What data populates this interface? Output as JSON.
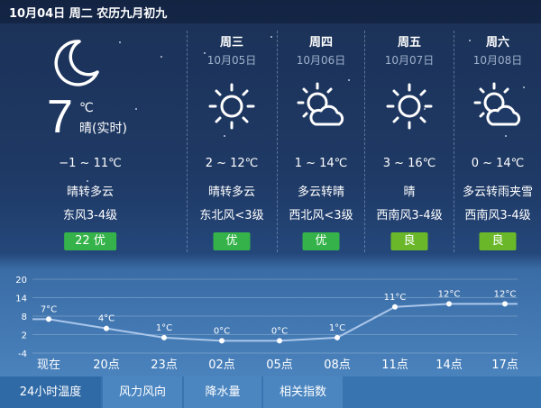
{
  "header": {
    "date_line": "10月04日 周二 农历九月初九"
  },
  "today": {
    "current_temp": "7",
    "unit": "℃",
    "realtime_label": "晴(实时)",
    "temp_range": "−1 ~ 11℃",
    "condition": "晴转多云",
    "wind": "东风3-4级",
    "aqi": "22  优",
    "icon": "moon-icon"
  },
  "forecast": [
    {
      "weekday": "周三",
      "date": "10月05日",
      "temp_range": "2 ~ 12℃",
      "condition": "晴转多云",
      "wind": "东北风<3级",
      "aqi": "优",
      "aqi_level": "good",
      "icon": "sun-icon"
    },
    {
      "weekday": "周四",
      "date": "10月06日",
      "temp_range": "1 ~ 14℃",
      "condition": "多云转晴",
      "wind": "西北风<3级",
      "aqi": "优",
      "aqi_level": "good",
      "icon": "partly-cloudy-icon"
    },
    {
      "weekday": "周五",
      "date": "10月07日",
      "temp_range": "3 ~ 16℃",
      "condition": "晴",
      "wind": "西南风3-4级",
      "aqi": "良",
      "aqi_level": "fair",
      "icon": "sun-icon"
    },
    {
      "weekday": "周六",
      "date": "10月08日",
      "temp_range": "0 ~ 14℃",
      "condition": "多云转雨夹雪",
      "wind": "西南风3-4级",
      "aqi": "良",
      "aqi_level": "fair",
      "icon": "partly-cloudy-icon"
    }
  ],
  "colors": {
    "aqi_good": "#35b34a",
    "aqi_fair": "#6ab82a",
    "line": "#aac6ea",
    "point": "#ffffff"
  },
  "chart_data": {
    "type": "line",
    "categories": [
      "现在",
      "20点",
      "23点",
      "02点",
      "05点",
      "08点",
      "11点",
      "14点",
      "17点"
    ],
    "values": [
      7,
      4,
      1,
      0,
      0,
      1,
      11,
      12,
      12
    ],
    "data_labels": [
      "7°C",
      "4°C",
      "1°C",
      "0°C",
      "0°C",
      "1°C",
      "11°C",
      "12°C",
      "12°C"
    ],
    "yticks": [
      "20",
      "14",
      "8",
      "2",
      "-4"
    ],
    "ylim": [
      -4,
      20
    ],
    "grid": true
  },
  "tabs": [
    {
      "label": "24小时温度",
      "active": true
    },
    {
      "label": "风力风向",
      "active": false
    },
    {
      "label": "降水量",
      "active": false
    },
    {
      "label": "相关指数",
      "active": false
    }
  ]
}
